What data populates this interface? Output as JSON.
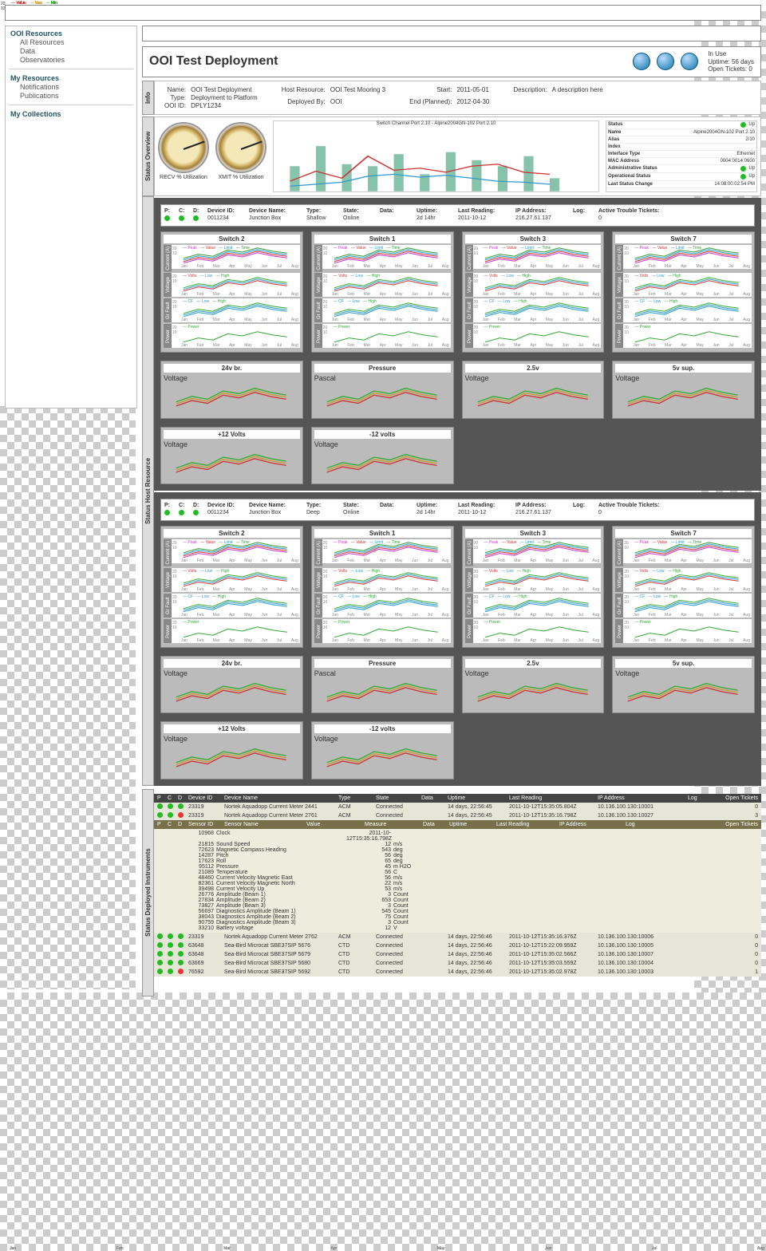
{
  "sidebar": {
    "g1": "OOI Resources",
    "g1a": "All Resources",
    "g1b": "Data",
    "g1c": "Observatories",
    "g2": "My Resources",
    "g2a": "Notifications",
    "g2b": "Publications",
    "g3": "My Collections"
  },
  "header": {
    "title": "OOI Test Deployment",
    "meta1": "In Use",
    "meta2": "Uptime: 56 days",
    "meta3": "Open Tickets: 0"
  },
  "info": {
    "tab": "Info",
    "name_l": "Name:",
    "name_v": "OOI Test Deployment",
    "type_l": "Type:",
    "type_v": "Deployment to Platform",
    "ooi_l": "OOI ID:",
    "ooi_v": "DPLY1234",
    "host_l": "Host Resource:",
    "host_v": "OOI Test Mooring 3",
    "dep_l": "Deployed By:",
    "dep_v": "OOI",
    "start_l": "Start:",
    "start_v": "2011-05-01",
    "end_l": "End (Planned):",
    "end_v": "2012-04-30",
    "desc_l": "Description:",
    "desc_v": "A description here"
  },
  "status": {
    "tab": "Status Overview",
    "g1": "RECV % Utilization",
    "g2": "XMIT % Utilization",
    "chart_title": "Switch Channel Port 2.10 - Alpine2004GN-102 Port 2.10",
    "st_status": "Status",
    "st_status_v": "Up",
    "st_name": "Name",
    "st_name_v": "Alpine2004GN-102 Port 2.10",
    "st_alias": "Alias",
    "st_alias_v": "2/10",
    "st_index": "Index",
    "st_index_v": "",
    "st_iftype": "Interface Type",
    "st_iftype_v": "Ethernet",
    "st_mac": "MAC Address",
    "st_mac_v": "0004:0014:0600",
    "st_admin": "Administrative Status",
    "st_admin_v": "Up",
    "st_oper": "Operational Status",
    "st_oper_v": "Up",
    "st_change": "Last Status Change",
    "st_change_v": "14:08:00:02:54 PM"
  },
  "hosthdr": {
    "p": "P:",
    "c": "C:",
    "d": "D:",
    "did": "Device ID:",
    "did_v": "0011234",
    "dname": "Device Name:",
    "dname_v": "Junction Box",
    "type": "Type:",
    "type_v1": "Shallow",
    "type_v2": "Deep",
    "state": "State:",
    "state_v": "Online",
    "data": "Data:",
    "uptime": "Uptime:",
    "uptime_v": "2d 14hr",
    "last": "Last Reading:",
    "last_v": "2011-10-12",
    "ip": "IP Address:",
    "ip_v": "216.27.61.137",
    "log": "Log:",
    "tickets": "Active Trouble Tickets:",
    "tickets_v": "0"
  },
  "host_tab": "Status Host Resource",
  "switches": [
    "Switch 2",
    "Switch 1",
    "Switch 3",
    "Switch 7"
  ],
  "metric_labels": {
    "current": "Current (A)",
    "voltage": "Voltage",
    "gfault": "Gr Fault",
    "power": "Power",
    "pascal": "Pascal"
  },
  "vcards1": [
    "24v br.",
    "Pressure",
    "2.5v",
    "5v sup."
  ],
  "vcards2": [
    "+12 Volts",
    "-12 volts"
  ],
  "months": [
    "Jan",
    "Feb",
    "Mar",
    "Apr",
    "May",
    "Jun",
    "Jul",
    "Aug"
  ],
  "legend_current": {
    "a": "Peak",
    "b": "Value",
    "c": "Limit",
    "d": "Time"
  },
  "legend_voltage": {
    "a": "Volts",
    "b": "Low",
    "c": "High"
  },
  "legend_gfault": {
    "a": "CF",
    "b": "Low",
    "c": "High"
  },
  "legend_power": {
    "a": "Power"
  },
  "legend_vcard": {
    "a": "Value",
    "b": "Max",
    "c": "Min"
  },
  "inst": {
    "tab": "Status Deployed Instruments",
    "hdr": {
      "p": "P",
      "c": "C",
      "d": "D",
      "did": "Device ID",
      "dname": "Device Name",
      "type": "Type",
      "state": "State",
      "data": "Data",
      "uptime": "Uptime",
      "last": "Last Reading",
      "ip": "IP Address",
      "log": "Log",
      "tickets": "Open Tickets"
    },
    "shdr": {
      "p": "P",
      "c": "C",
      "d": "D",
      "sid": "Sensor ID",
      "sname": "Sensor Name",
      "value": "Value",
      "measure": "Measure",
      "data": "Data",
      "uptime": "Uptime",
      "last": "Last Reading",
      "ip": "IP Address",
      "log": "Log",
      "tickets": "Open Tickets"
    },
    "rows": [
      {
        "did": "23319",
        "name": "Nortek Aquadopp Current Meter 2441",
        "type": "ACM",
        "state": "Connected",
        "uptime": "14 days, 22:56:45",
        "last": "2011-10-12T15:35:05.804Z",
        "ip": "10.136.100.130:10001",
        "t": "0"
      },
      {
        "did": "23319",
        "name": "Nortek Aquadopp Current Meter 2761",
        "type": "ACM",
        "state": "Connected",
        "uptime": "14 days, 22:56:45",
        "last": "2011-10-12T15:35:16.798Z",
        "ip": "10.136.100.130:10027",
        "t": "3"
      }
    ],
    "clock": "2011-10-12T15:35:16.798Z",
    "sensors": [
      {
        "id": "10968",
        "name": "Clock",
        "val": "",
        "m": ""
      },
      {
        "id": "21815",
        "name": "Sound Speed",
        "val": "12",
        "m": "m/s"
      },
      {
        "id": "72623",
        "name": "Magnetic Compass Heading",
        "val": "543",
        "m": "deg"
      },
      {
        "id": "14287",
        "name": "Pitch",
        "val": "56",
        "m": "deg"
      },
      {
        "id": "17623",
        "name": "Roll",
        "val": "65",
        "m": "deg"
      },
      {
        "id": "95112",
        "name": "Pressure",
        "val": "45",
        "m": "m H2O"
      },
      {
        "id": "21089",
        "name": "Temperature",
        "val": "56",
        "m": "C"
      },
      {
        "id": "48460",
        "name": "Current Velocity Magnetic East",
        "val": "56",
        "m": "m/s"
      },
      {
        "id": "82361",
        "name": "Current Velocity Magnetic North",
        "val": "22",
        "m": "m/s"
      },
      {
        "id": "39498",
        "name": "Current Velocity Up",
        "val": "53",
        "m": "m/s"
      },
      {
        "id": "26776",
        "name": "Amplitude (Beam 1)",
        "val": "3",
        "m": "Count"
      },
      {
        "id": "27834",
        "name": "Amplitude (Beam 2)",
        "val": "653",
        "m": "Count"
      },
      {
        "id": "73827",
        "name": "Amplitude (Beam 3)",
        "val": "3",
        "m": "Count"
      },
      {
        "id": "56697",
        "name": "Diagnostics Amplitude (Beam 1)",
        "val": "545",
        "m": "Count"
      },
      {
        "id": "38043",
        "name": "Diagnostics Amplitude (Beam 2)",
        "val": "75",
        "m": "Count"
      },
      {
        "id": "90759",
        "name": "Diagnostics Amplitude (Beam 3)",
        "val": "3",
        "m": "Count"
      },
      {
        "id": "33210",
        "name": "Battery voltage",
        "val": "12",
        "m": "V"
      }
    ],
    "rows2": [
      {
        "did": "23319",
        "name": "Nortek Aquadopp Current Meter 2762",
        "type": "ACM",
        "state": "Connected",
        "uptime": "14 days, 22:56:46",
        "last": "2011-10-12T15:35:16.376Z",
        "ip": "10.136.100.130:10006",
        "t": "0"
      },
      {
        "did": "63648",
        "name": "Sea-Bird Microcat SBE37SIP 5676",
        "type": "CTD",
        "state": "Connected",
        "uptime": "14 days, 22:56:46",
        "last": "2011-10-12T15:22:09.959Z",
        "ip": "10.136.100.130:10005",
        "t": "0"
      },
      {
        "did": "63648",
        "name": "Sea-Bird Microcat SBE37SIP 5679",
        "type": "CTD",
        "state": "Connected",
        "uptime": "14 days, 22:56:46",
        "last": "2011-10-12T15:35:02.566Z",
        "ip": "10.136.100.130:10007",
        "t": "0"
      },
      {
        "did": "63669",
        "name": "Sea-Bird Microcat SBE37SIP 5680",
        "type": "CTD",
        "state": "Connected",
        "uptime": "14 days, 22:56:46",
        "last": "2011-10-12T15:35:03.559Z",
        "ip": "10.136.100.130:10004",
        "t": "0"
      },
      {
        "did": "76592",
        "name": "Sea-Bird Microcat SBE37SIP 5692",
        "type": "CTD",
        "state": "Connected",
        "uptime": "14 days, 22:56:46",
        "last": "2011-10-12T15:35:02.978Z",
        "ip": "10.136.100.130:10003",
        "t": "1"
      }
    ]
  },
  "chart_data": {
    "overview": {
      "type": "bar+line",
      "title": "Switch Channel Port 2.10",
      "ylim": [
        0,
        5
      ],
      "x": [
        "0",
        "2",
        "4",
        "6",
        "8",
        "10",
        "12",
        "14",
        "16",
        "18",
        "20"
      ],
      "bars": [
        2.1,
        3.8,
        2.2,
        2.0,
        3.2,
        1.6,
        3.4,
        2.6,
        2.0,
        3.0,
        1.2
      ],
      "line1": [
        1.0,
        1.8,
        1.2,
        3.0,
        1.8,
        2.0,
        1.6,
        2.2,
        2.4,
        1.6,
        1.4
      ],
      "line2": [
        0.6,
        0.8,
        1.0,
        1.4,
        1.6,
        1.3,
        1.5,
        1.2,
        1.0,
        0.9,
        0.8
      ]
    },
    "switch_metric": {
      "type": "line",
      "x": [
        "Jan",
        "Feb",
        "Mar",
        "Apr",
        "May",
        "Jun",
        "Jul",
        "Aug"
      ],
      "ylim": [
        0,
        20
      ],
      "series_example": [
        4,
        8,
        6,
        12,
        10,
        14,
        11,
        9
      ]
    }
  }
}
